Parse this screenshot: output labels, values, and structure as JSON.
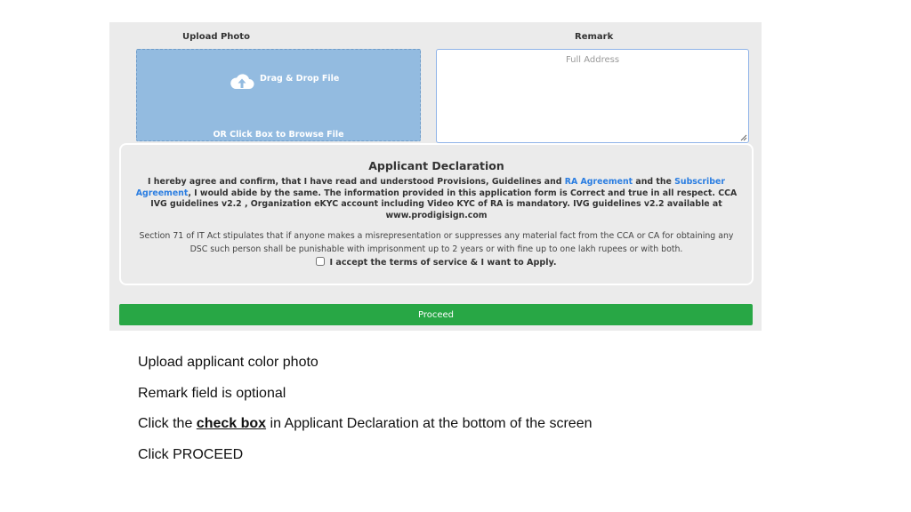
{
  "form": {
    "upload": {
      "label": "Upload Photo",
      "drag_text": "Drag & Drop File",
      "browse_text": "OR Click Box to Browse File",
      "icon": "cloud-upload-icon"
    },
    "remark": {
      "label": "Remark",
      "placeholder": "Full Address",
      "value": ""
    },
    "declaration": {
      "title": "Applicant Declaration",
      "text_1": "I hereby agree and confirm, that I have read and understood Provisions, Guidelines and ",
      "link_ra": "RA Agreement",
      "text_2": " and the ",
      "link_subscriber": "Subscriber Agreement",
      "text_3": ", I would abide by the same. The information provided in this application form is Correct and true in all respect. CCA IVG guidelines v2.2 , Organization eKYC account including Video KYC of RA is mandatory. IVG guidelines v2.2 available at www.prodigisign.com",
      "legal": "Section 71 of IT Act stipulates that if anyone makes a misrepresentation or suppresses any material fact from the CCA or CA for obtaining any DSC such person shall be punishable with imprisonment up to 2 years or with fine up to one lakh rupees or with both.",
      "accept_label": "I accept the terms of service & I want to Apply.",
      "accepted": false
    },
    "proceed_label": "Proceed",
    "colors": {
      "proceed": "#28a745",
      "upload_box": "#93bbe0",
      "link": "#2a7de1"
    }
  },
  "instructions": {
    "line1": "Upload applicant color photo",
    "line2": "Remark field is optional",
    "line3_before": "Click the ",
    "line3_emphasis": "check box",
    "line3_after": " in Applicant Declaration at the bottom of the screen",
    "line4": "Click PROCEED"
  }
}
